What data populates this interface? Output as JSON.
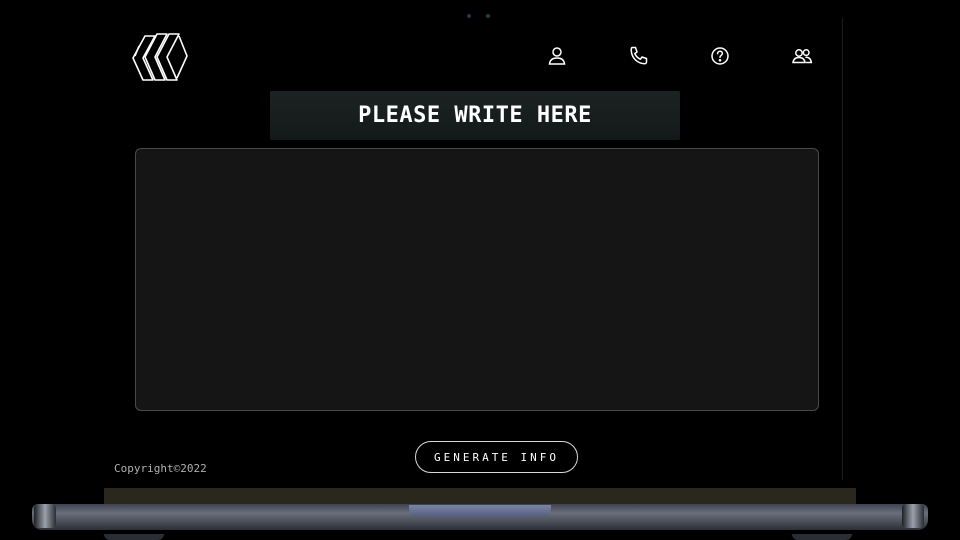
{
  "header": {
    "logo_icon": "stacked-s-logo-icon",
    "nav_icons": [
      {
        "name": "user-icon",
        "label": "Profile"
      },
      {
        "name": "phone-icon",
        "label": "Contact"
      },
      {
        "name": "help-icon",
        "label": "Help"
      },
      {
        "name": "users-icon",
        "label": "Team"
      }
    ]
  },
  "main": {
    "title": "PLEASE WRITE HERE",
    "input_value": "",
    "input_placeholder": ""
  },
  "actions": {
    "generate_label": "GENERATE INFO"
  },
  "footer": {
    "copyright": "Copyright©2022"
  },
  "colors": {
    "background": "#000000",
    "banner": "#1a2121",
    "textarea_bg": "#151515",
    "text": "#ffffff"
  }
}
